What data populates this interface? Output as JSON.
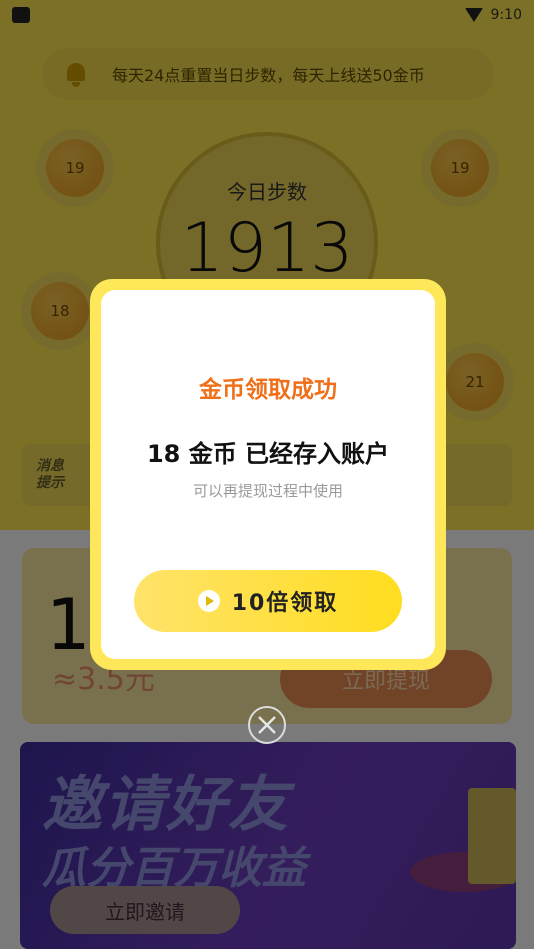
{
  "status_bar": {
    "time": "9:10"
  },
  "notice": {
    "text": "每天24点重置当日步数，每天上线送50金币"
  },
  "coins": [
    {
      "label": "19"
    },
    {
      "label": "19"
    },
    {
      "label": "18"
    },
    {
      "label": "21"
    }
  ],
  "dial": {
    "label": "今日步数",
    "steps": "1913"
  },
  "message_tag": "消息提示",
  "balance_card": {
    "amount_partial": "1",
    "approx_partial": "≈3.5元",
    "withdraw_label": "立即提现"
  },
  "banner": {
    "title": "邀请好友",
    "subtitle": "瓜分百万收益",
    "invite_label": "立即邀请"
  },
  "dialog": {
    "title": "金币领取成功",
    "message": "18 金币 已经存入账户",
    "subtitle": "可以再提现过程中使用",
    "cta_label": "10倍领取"
  },
  "colors": {
    "accent_yellow": "#ffe75a",
    "title_orange": "#f0701a"
  }
}
